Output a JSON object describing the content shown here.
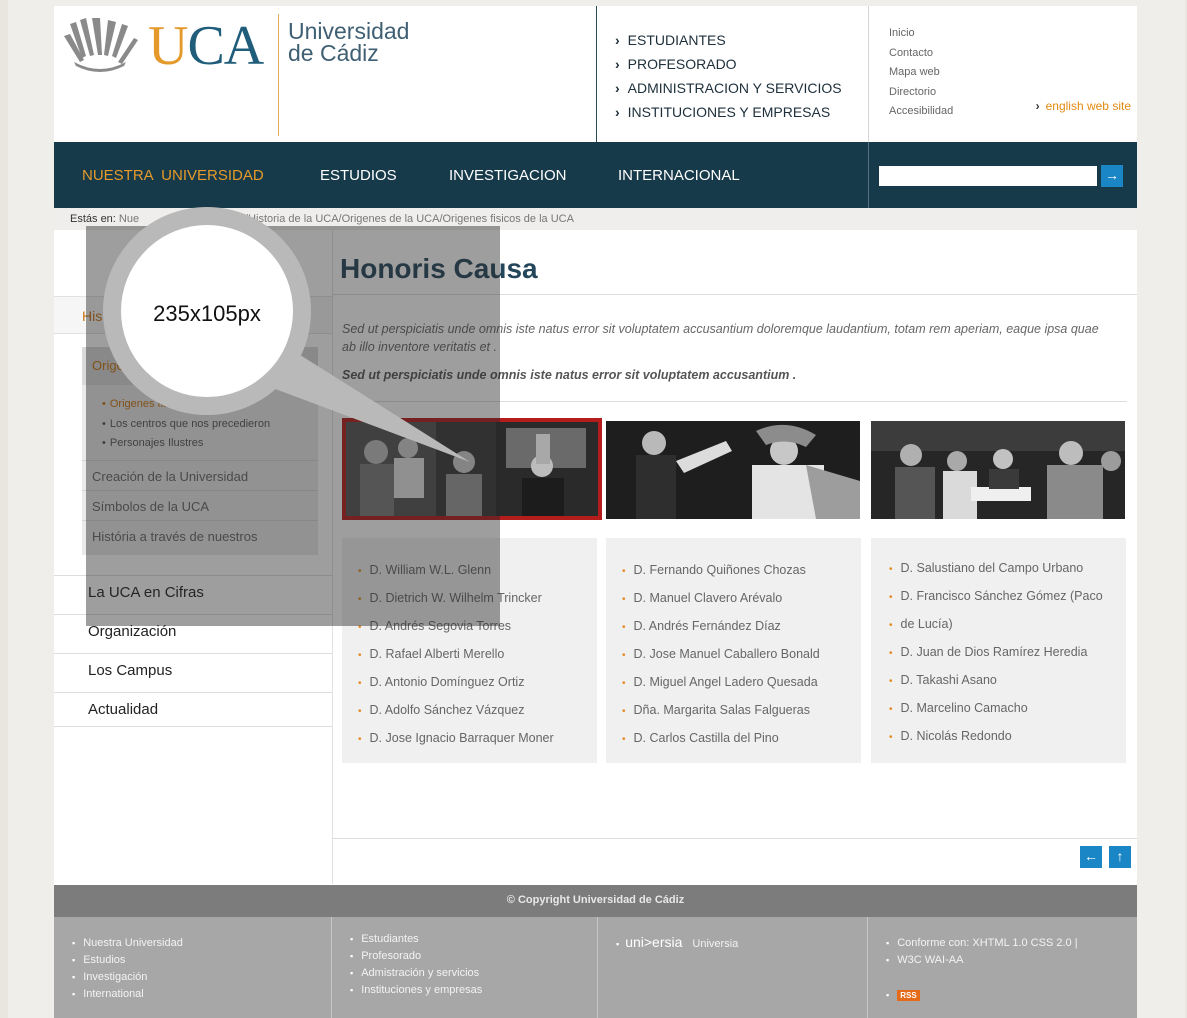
{
  "logo": {
    "mark": "UCA",
    "line1": "Universidad",
    "line2": "de Cádiz"
  },
  "header_links": [
    "ESTUDIANTES",
    "PROFESORADO",
    "ADMINISTRACION Y SERVICIOS",
    "INSTITUCIONES Y EMPRESAS"
  ],
  "utility_links": [
    "Inicio",
    "Contacto",
    "Mapa web",
    "Directorio",
    "Accesibilidad"
  ],
  "english_link": "english web site",
  "nav": [
    "NUESTRA  UNIVERSIDAD",
    "ESTUDIOS",
    "INVESTIGACION",
    "INTERNACIONAL"
  ],
  "search": {
    "value": "",
    "button": "→"
  },
  "breadcrumb": {
    "label": "Estás en:",
    "visible_start": "Nue",
    "trail": [
      "Historia de la UCA",
      "Origenes de la UCA",
      "Origenes fisicos de la UCA"
    ]
  },
  "sidebar": {
    "top_item": "His",
    "selected_sub": "Orige",
    "sub_links": [
      "Origenes fisicos",
      "Los centros que nos precedieron",
      "Personajes Ilustres"
    ],
    "sub_items": [
      "Creación de la Universidad",
      "Símbolos de la UCA",
      "História a través de nuestros"
    ],
    "main_items": [
      "La UCA en Cifras",
      "Organización",
      "Los Campus",
      "Actualidad"
    ]
  },
  "main": {
    "title": "Honoris Causa",
    "intro": "Sed ut perspiciatis unde omnis iste natus error sit voluptatem accusantium doloremque laudantium, totam rem aperiam, eaque ipsa quae ab illo inventore veritatis et .",
    "intro_bold": "Sed ut perspiciatis unde omnis iste natus error sit voluptatem accusantium ."
  },
  "columns": [
    [
      "D. William W.L. Glenn",
      "D. Dietrich W. Wilhelm Trincker",
      "D. Andrés Segovia Torres",
      "D. Rafael Alberti Merello",
      "D. Antonio Domínguez Ortiz",
      "D. Adolfo Sánchez Vázquez",
      "D. Jose Ignacio Barraquer Moner"
    ],
    [
      "D. Fernando Quiñones Chozas",
      "D. Manuel Clavero Arévalo",
      "D. Andrés Fernández Díaz",
      "D. Jose Manuel Caballero Bonald",
      "D. Miguel Angel Ladero Quesada",
      "Dña. Margarita Salas Falgueras",
      "D. Carlos Castilla del Pino"
    ],
    [
      "D. Salustiano del Campo Urbano",
      "D. Francisco Sánchez Gómez (Paco",
      "de Lucía)",
      "D. Juan de Dios Ramírez Heredia",
      "D. Takashi Asano",
      "D. Marcelino Camacho",
      "D. Nicolás Redondo"
    ]
  ],
  "pager": {
    "prev": "←",
    "top": "↑"
  },
  "footer": {
    "copyright": "© Copyright Universidad de Cádiz",
    "col1": [
      "Nuestra Universidad",
      "Estudios",
      "Investigación",
      "International"
    ],
    "col2": [
      "Estudiantes",
      "Profesorado",
      "Admistración y servicios",
      "Instituciones y empresas"
    ],
    "universia_logo": "uni>ersia",
    "universia_text": "Universia",
    "col4": [
      "Conforme con: XHTML 1.0  CSS 2.0 |",
      "W3C WAI-AA"
    ],
    "rss": "RSS"
  },
  "magnifier": {
    "label": "235x105px"
  },
  "colors": {
    "nav_bg": "#173a4a",
    "accent_orange": "#e59a2a",
    "selected_border": "#b51d1d",
    "button_blue": "#1b86c6"
  }
}
